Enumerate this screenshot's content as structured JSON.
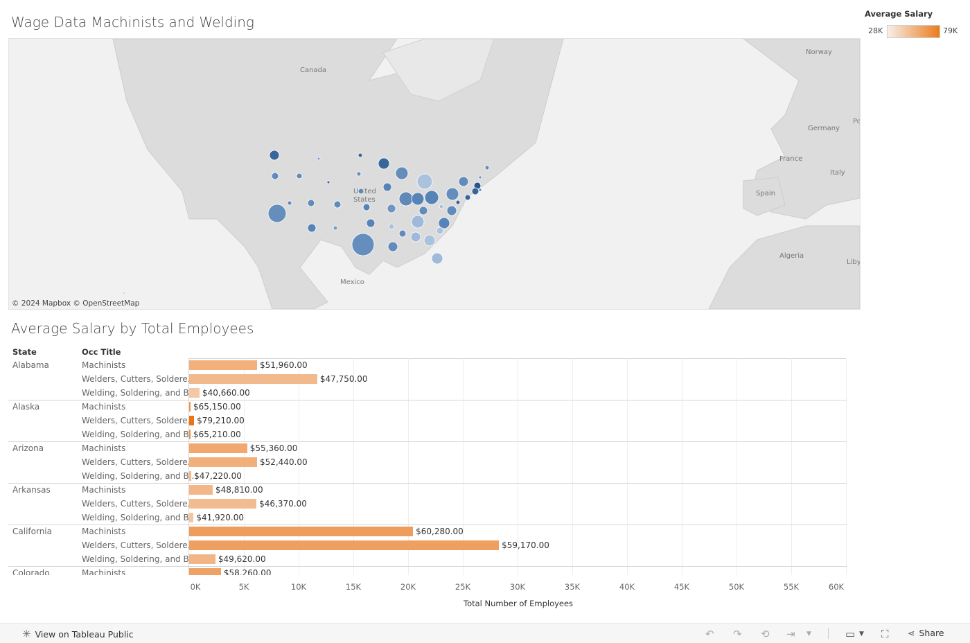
{
  "map": {
    "title": "Wage Data Machinists and Welding",
    "attribution": "© 2024 Mapbox  © OpenStreetMap",
    "geo_labels": [
      "Canada",
      "United States",
      "Mexico",
      "Norway",
      "Germany",
      "France",
      "Italy",
      "Spain",
      "Algeria",
      "Liby",
      "Po"
    ]
  },
  "legend": {
    "title": "Average Salary",
    "min": "28K",
    "max": "79K",
    "color_low": "#f7efe9",
    "color_high": "#ea7c1c"
  },
  "bar_chart": {
    "title": "Average Salary by Total Employees",
    "col_state": "State",
    "col_occ": "Occ Title",
    "x_title": "Total Number of Employees",
    "ticks": [
      "0K",
      "5K",
      "10K",
      "15K",
      "20K",
      "25K",
      "30K",
      "35K",
      "40K",
      "45K",
      "50K",
      "55K",
      "60K"
    ]
  },
  "chart_data": {
    "type": "bar",
    "orientation": "horizontal",
    "title": "Average Salary by Total Employees",
    "xlabel": "Total Number of Employees",
    "xlim": [
      0,
      60000
    ],
    "color_by": "Average Salary",
    "rows": [
      {
        "state": "Alabama",
        "occ": "Machinists",
        "employees": 6200,
        "salary_label": "$51,960.00",
        "salary": 51960
      },
      {
        "state": "",
        "occ": "Welders, Cutters, Soldere..",
        "employees": 11700,
        "salary_label": "$47,750.00",
        "salary": 47750
      },
      {
        "state": "",
        "occ": "Welding, Soldering, and B..",
        "employees": 950,
        "salary_label": "$40,660.00",
        "salary": 40660
      },
      {
        "state": "Alaska",
        "occ": "Machinists",
        "employees": 120,
        "salary_label": "$65,150.00",
        "salary": 65150
      },
      {
        "state": "",
        "occ": "Welders, Cutters, Soldere..",
        "employees": 450,
        "salary_label": "$79,210.00",
        "salary": 79210
      },
      {
        "state": "",
        "occ": "Welding, Soldering, and B..",
        "employees": 30,
        "salary_label": "$65,210.00",
        "salary": 65210
      },
      {
        "state": "Arizona",
        "occ": "Machinists",
        "employees": 5300,
        "salary_label": "$55,360.00",
        "salary": 55360
      },
      {
        "state": "",
        "occ": "Welders, Cutters, Soldere..",
        "employees": 6200,
        "salary_label": "$52,440.00",
        "salary": 52440
      },
      {
        "state": "",
        "occ": "Welding, Soldering, and B..",
        "employees": 200,
        "salary_label": "$47,220.00",
        "salary": 47220
      },
      {
        "state": "Arkansas",
        "occ": "Machinists",
        "employees": 2150,
        "salary_label": "$48,810.00",
        "salary": 48810
      },
      {
        "state": "",
        "occ": "Welders, Cutters, Soldere..",
        "employees": 6150,
        "salary_label": "$46,370.00",
        "salary": 46370
      },
      {
        "state": "",
        "occ": "Welding, Soldering, and B..",
        "employees": 400,
        "salary_label": "$41,920.00",
        "salary": 41920
      },
      {
        "state": "California",
        "occ": "Machinists",
        "employees": 20450,
        "salary_label": "$60,280.00",
        "salary": 60280
      },
      {
        "state": "",
        "occ": "Welders, Cutters, Soldere..",
        "employees": 28300,
        "salary_label": "$59,170.00",
        "salary": 59170
      },
      {
        "state": "",
        "occ": "Welding, Soldering, and B..",
        "employees": 2400,
        "salary_label": "$49,620.00",
        "salary": 49620
      },
      {
        "state": "Colorado",
        "occ": "Machinists",
        "employees": 2900,
        "salary_label": "$58,260.00",
        "salary": 58260
      }
    ]
  },
  "footer": {
    "view_label": "View on Tableau Public",
    "share_label": "Share"
  }
}
